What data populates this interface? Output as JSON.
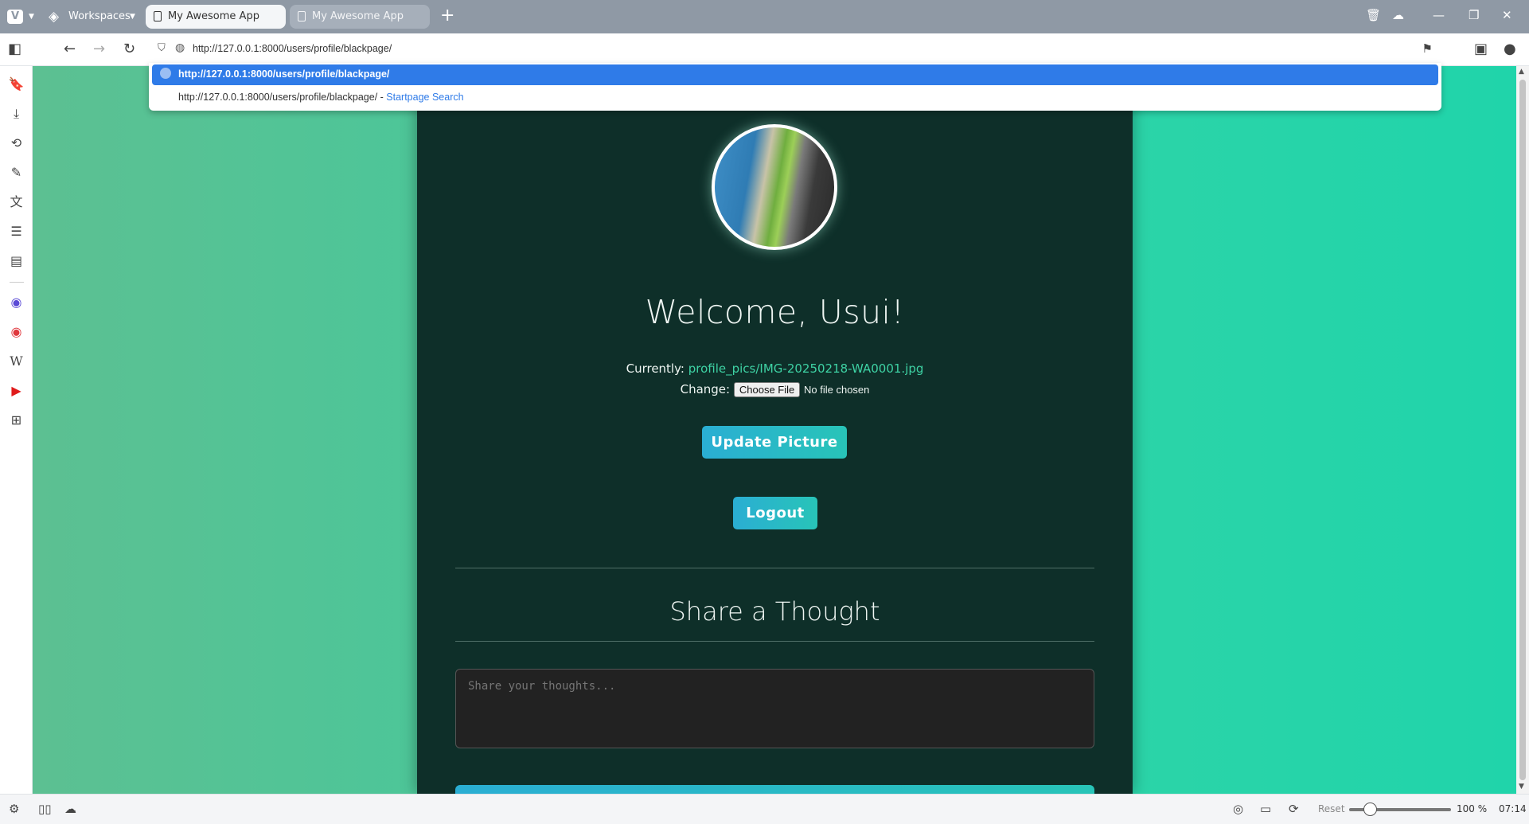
{
  "browser": {
    "workspaces_label": "Workspaces",
    "tabs": [
      {
        "title": "My Awesome App",
        "active": true
      },
      {
        "title": "My Awesome App",
        "active": false
      }
    ],
    "address_bar": {
      "url": "http://127.0.0.1:8000/users/profile/blackpage/"
    },
    "suggestions": [
      {
        "text": "http://127.0.0.1:8000/users/profile/blackpage/",
        "selected": true
      },
      {
        "text": "http://127.0.0.1:8000/users/profile/blackpage/",
        "suffix": " - ",
        "source": "Startpage Search",
        "selected": false
      }
    ],
    "status_bar": {
      "reset_label": "Reset",
      "zoom": "100 %",
      "time": "07:14",
      "zoom_fraction": 0.15
    }
  },
  "page": {
    "welcome": "Welcome, Usui!",
    "current_label": "Currently:",
    "current_file": "profile_pics/IMG-20250218-WA0001.jpg",
    "change_label": "Change:",
    "choose_file_label": "Choose File",
    "no_file_label": "No file chosen",
    "update_button": "Update Picture",
    "logout_button": "Logout",
    "share_title": "Share a Thought",
    "thought_placeholder": "Share your thoughts..."
  },
  "colors": {
    "accent_blue": "#2f7be8",
    "card_bg": "#0e2f29",
    "link_green": "#3ed2a4",
    "button_gradient_start": "#2aaed3",
    "button_gradient_end": "#28c4b8"
  },
  "icons": {
    "sidebar": [
      "bookmarks-icon",
      "downloads-icon",
      "history-icon",
      "notes-icon",
      "translate-icon",
      "reading-list-icon",
      "reader-icon",
      "mastodon-icon",
      "vivaldi-icon",
      "wikipedia-icon",
      "youtube-icon",
      "add-panel-icon"
    ]
  }
}
